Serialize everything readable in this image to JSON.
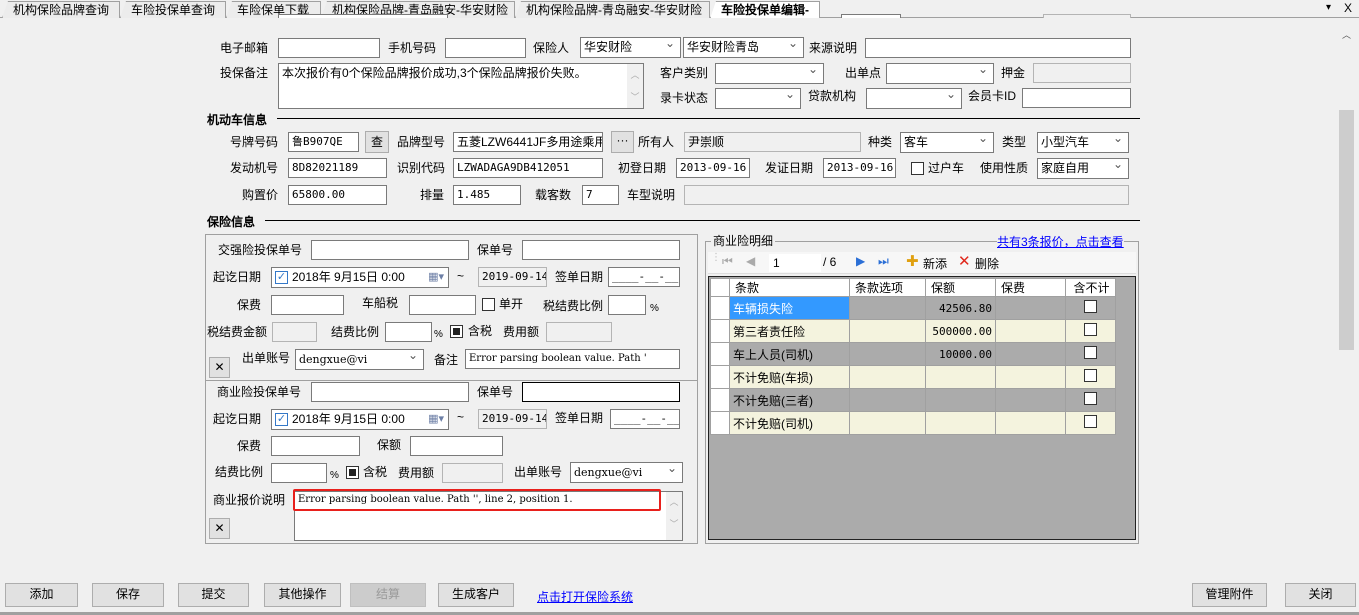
{
  "tabs": [
    "机构保险品牌查询",
    "车险投保单查询",
    "车险保单下载",
    "机构保险品牌-青岛融安-华安财险",
    "机构保险品牌-青岛融安-华安财险",
    "车险投保单编辑-"
  ],
  "tab_controls": {
    "menu": "▾",
    "close": "X"
  },
  "customer": {
    "email_label": "电子邮箱",
    "email": "",
    "phone_label": "手机号码",
    "phone": "",
    "insurer_label": "保险人",
    "insurer": "华安财险",
    "insurer_branch": "华安财险青岛",
    "source_label": "来源说明",
    "source": "",
    "remark_label": "投保备注",
    "remark": "本次报价有0个保险品牌报价成功,3个保险品牌报价失败。",
    "customer_type_label": "客户类别",
    "customer_type": "",
    "issue_point_label": "出单点",
    "issue_point": "",
    "deposit_label": "押金",
    "deposit": "",
    "card_status_label": "录卡状态",
    "card_status": "",
    "loan_org_label": "贷款机构",
    "loan_org": "",
    "member_card_label": "会员卡ID",
    "member_card": ""
  },
  "vehicle": {
    "section_title": "机动车信息",
    "plate_label": "号牌号码",
    "plate": "鲁B907QE",
    "lookup_button": "查",
    "brand_label": "品牌型号",
    "brand": "五菱LZW6441JF多用途乘用车",
    "brand_button": "···",
    "owner_label": "所有人",
    "owner": "尹崇顺",
    "kind_label": "种类",
    "kind": "客车",
    "type_label": "类型",
    "type": "小型汽车",
    "engine_label": "发动机号",
    "engine": "8D82021189",
    "vin_label": "识别代码",
    "vin": "LZWADAGA9DB412051",
    "first_reg_label": "初登日期",
    "first_reg": "2013-09-16",
    "cert_date_label": "发证日期",
    "cert_date": "2013-09-16",
    "transfer_label": "过户车",
    "usage_label": "使用性质",
    "usage": "家庭自用",
    "price_label": "购置价",
    "price": "65800.00",
    "displacement_label": "排量",
    "displacement": "1.485",
    "seats_label": "载客数",
    "seats": "7",
    "model_desc_label": "车型说明",
    "model_desc": ""
  },
  "insurance": {
    "section_title": "保险信息",
    "compulsory": {
      "app_no_label": "交强险投保单号",
      "app_no": "",
      "policy_no_label": "保单号",
      "policy_no": "",
      "period_label": "起讫日期",
      "start": "2018年  9月15日    0:00",
      "tilde": "~",
      "end": "2019-09-14",
      "sign_date_label": "签单日期",
      "sign_date": "____-__-__",
      "premium_label": "保费",
      "premium": "",
      "vessel_tax_label": "车船税",
      "vessel_tax": "",
      "separate_label": "单开",
      "tax_fee_ratio_label": "税结费比例",
      "tax_fee_ratio": "",
      "pct": "%",
      "tax_fee_amount_label": "税结费金额",
      "tax_fee_amount": "",
      "fee_ratio_label": "结费比例",
      "fee_ratio": "",
      "tax_incl_label": "含税",
      "fee_amount_label": "费用额",
      "fee_amount": "",
      "account_label": "出单账号",
      "account": "dengxue@vi",
      "note_label": "备注",
      "note": "Error parsing boolean value. Path '",
      "clear_button": "✕"
    },
    "commercial": {
      "app_no_label": "商业险投保单号",
      "app_no": "",
      "policy_no_label": "保单号",
      "policy_no": "",
      "period_label": "起讫日期",
      "start": "2018年  9月15日    0:00",
      "tilde": "~",
      "end": "2019-09-14",
      "sign_date_label": "签单日期",
      "sign_date": "____-__-__",
      "premium_label": "保费",
      "premium": "",
      "amount_label": "保额",
      "amount": "",
      "fee_ratio_label": "结费比例",
      "fee_ratio": "",
      "pct": "%",
      "tax_incl_label": "含税",
      "fee_amount_label": "费用额",
      "fee_amount": "",
      "account_label": "出单账号",
      "account": "dengxue@vi",
      "quote_desc_label": "商业报价说明",
      "quote_desc": "Error parsing boolean value. Path '', line 2, position 1.",
      "clear_button": "✕"
    },
    "detail": {
      "title": "商业险明细",
      "quotes_link": "共有3条报价，点击查看",
      "nav": {
        "page": "1",
        "total": "/ 6",
        "add": "新添",
        "delete": "删除"
      },
      "columns": [
        "条款",
        "条款选项",
        "保额",
        "保费",
        "含不计"
      ],
      "rows": [
        {
          "clause": "车辆损失险",
          "option": "",
          "amount": "42506.80",
          "premium": ""
        },
        {
          "clause": "第三者责任险",
          "option": "",
          "amount": "500000.00",
          "premium": ""
        },
        {
          "clause": "车上人员(司机)",
          "option": "",
          "amount": "10000.00",
          "premium": ""
        },
        {
          "clause": "不计免赔(车损)",
          "option": "",
          "amount": "",
          "premium": ""
        },
        {
          "clause": "不计免赔(三者)",
          "option": "",
          "amount": "",
          "premium": ""
        },
        {
          "clause": "不计免赔(司机)",
          "option": "",
          "amount": "",
          "premium": ""
        }
      ]
    }
  },
  "footer": {
    "add": "添加",
    "save": "保存",
    "submit": "提交",
    "other": "其他操作",
    "settle": "结算",
    "gen_customer": "生成客户",
    "open_link": "点击打开保险系统",
    "attachments": "管理附件",
    "close": "关闭"
  }
}
